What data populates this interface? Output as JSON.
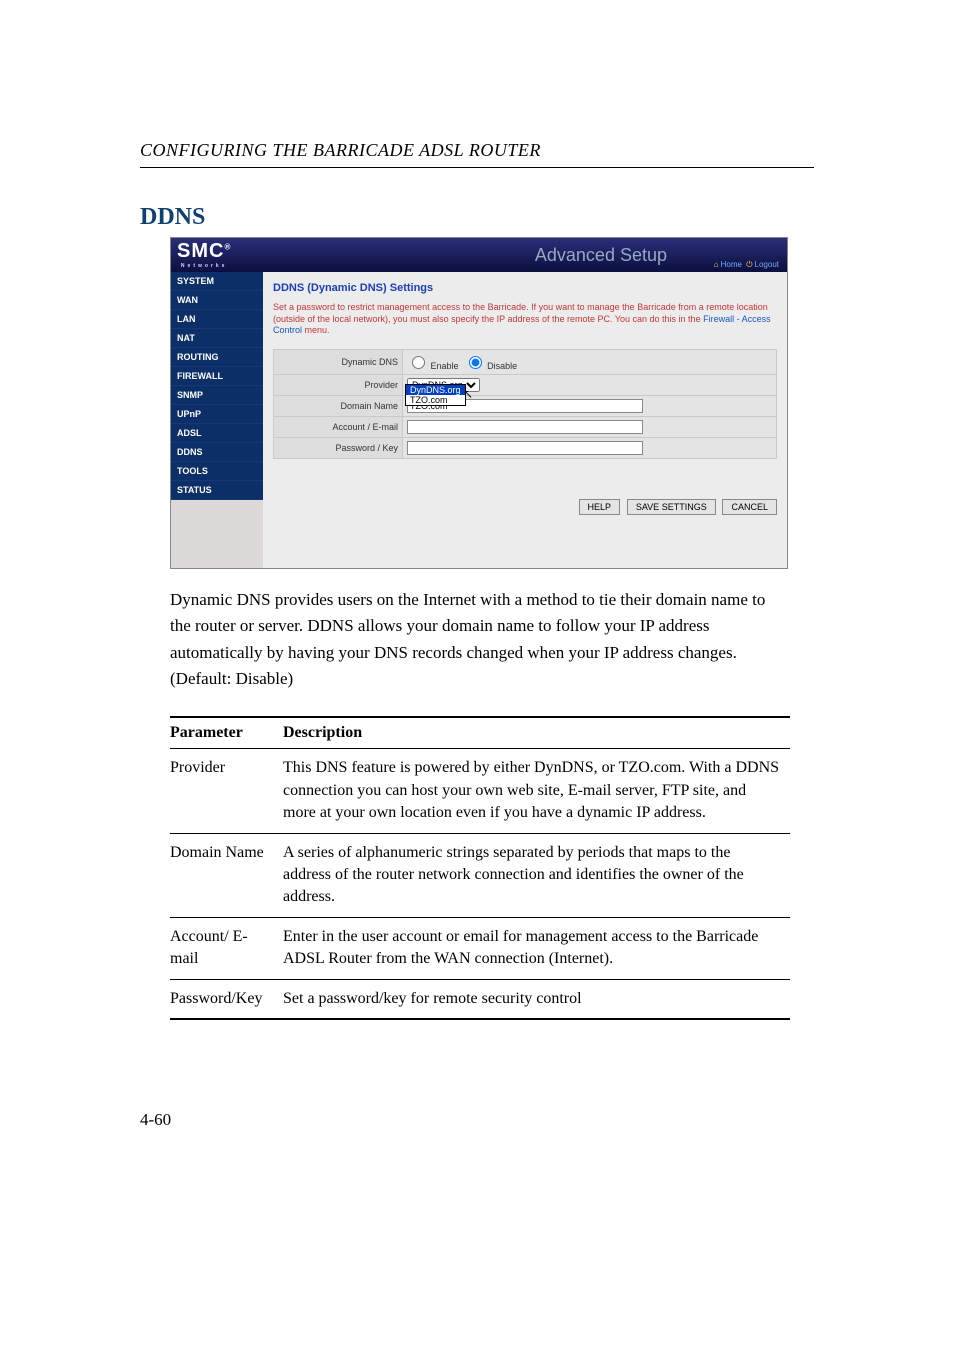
{
  "running_head": "CONFIGURING THE BARRICADE ADSL ROUTER",
  "h2": "DDNS",
  "screenshot": {
    "logo": "SMC",
    "logo_sub": "Networks",
    "title": "Advanced Setup",
    "home": "Home",
    "logout": "Logout",
    "nav": [
      "SYSTEM",
      "WAN",
      "LAN",
      "NAT",
      "ROUTING",
      "FIREWALL",
      "SNMP",
      "UPnP",
      "ADSL",
      "DDNS",
      "TOOLS",
      "STATUS"
    ],
    "heading": "DDNS (Dynamic DNS) Settings",
    "note_pre": "Set a password to restrict management access to the Barricade. If you want to manage the Barricade from a remote location (outside of the local network), you must also specify the IP address of the remote PC. You can do this in the ",
    "note_link": "Firewall - Access Control",
    "note_post": " menu.",
    "rows": {
      "dynamic_dns": {
        "label": "Dynamic DNS",
        "enable": "Enable",
        "disable": "Disable"
      },
      "provider": {
        "label": "Provider",
        "value": "DynDNS.org"
      },
      "domain_name": {
        "label": "Domain Name",
        "value": "TZO.com"
      },
      "account": {
        "label": "Account / E-mail",
        "value": ""
      },
      "password": {
        "label": "Password / Key",
        "value": ""
      }
    },
    "dropdown": [
      "DynDNS.org",
      "TZO.com"
    ],
    "buttons": {
      "help": "HELP",
      "save": "SAVE SETTINGS",
      "cancel": "CANCEL"
    }
  },
  "body_para": "Dynamic DNS provides users on the Internet with a method to tie their domain name to the router or server. DDNS allows your domain name to follow your IP address automatically by having your DNS records changed when your IP address changes. (Default: Disable)",
  "table": {
    "headers": {
      "param": "Parameter",
      "desc": "Description"
    },
    "rows": [
      {
        "param": "Provider",
        "desc": "This DNS feature is powered by either DynDNS, or TZO.com. With a DDNS connection you can host your own web site, E-mail server, FTP site, and more at your own location even if you have a dynamic IP address."
      },
      {
        "param": "Domain Name",
        "desc": "A series of alphanumeric strings separated by periods that maps to the address of the router network connection and identifies the owner of the address."
      },
      {
        "param": "Account/ E-mail",
        "desc": "Enter in the user account or email for management access to the Barricade ADSL Router from the WAN connection (Internet)."
      },
      {
        "param": "Password/Key",
        "desc": "Set a password/key for remote security control"
      }
    ]
  },
  "page_num": "4-60"
}
